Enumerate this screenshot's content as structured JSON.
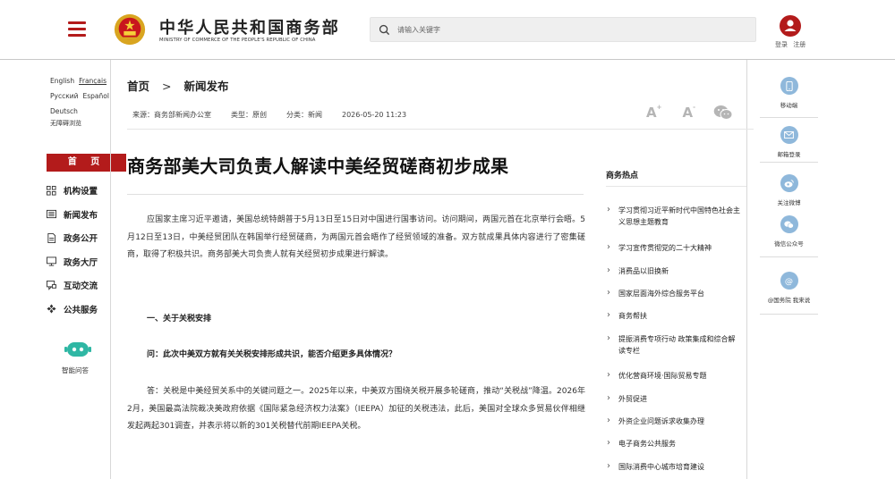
{
  "header": {
    "site_name_cn": "中华人民共和国商务部",
    "site_name_en": "MINISTRY OF COMMERCE OF THE PEOPLE'S REPUBLIC OF CHINA",
    "search_placeholder": "请输入关键字",
    "login": "登录",
    "register": "注册"
  },
  "languages": {
    "english": "English",
    "francais": "Français",
    "russian": "Русский",
    "espanol": "Español",
    "deutsch": "Deutsch",
    "accessibility": "无障碍浏览"
  },
  "left_nav": {
    "home": "首 页",
    "items": [
      {
        "label": "机构设置",
        "icon": "org-icon"
      },
      {
        "label": "新闻发布",
        "icon": "news-icon"
      },
      {
        "label": "政务公开",
        "icon": "document-icon"
      },
      {
        "label": "政务大厅",
        "icon": "monitor-icon"
      },
      {
        "label": "互动交流",
        "icon": "chat-icon"
      },
      {
        "label": "公共服务",
        "icon": "service-icon"
      }
    ],
    "chatbot_label": "智能问答"
  },
  "breadcrumb": {
    "home": "首页",
    "separator": ">",
    "current": "新闻发布"
  },
  "meta": {
    "source": "来源：商务部新闻办公室",
    "type": "类型：原创",
    "category": "分类：新闻",
    "datetime": "2026-05-20 11:23",
    "font_large": "A",
    "font_small": "A"
  },
  "article": {
    "title": "商务部美大司负责人解读中美经贸磋商初步成果",
    "paragraph1": "应国家主席习近平邀请，美国总统特朗普于5月13日至15日对中国进行国事访问。访问期间，两国元首在北京举行会晤。5月12日至13日，中美经贸团队在韩国举行经贸磋商，为两国元首会晤作了经贸领域的准备。双方就成果具体内容进行了密集磋商，取得了积极共识。商务部美大司负责人就有关经贸初步成果进行解读。",
    "section1": "一、关于关税安排",
    "question1": "问：此次中美双方就有关关税安排形成共识，能否介绍更多具体情况？",
    "answer1": "答：关税是中美经贸关系中的关键问题之一。2025年以来，中美双方围绕关税开展多轮磋商，推动“关税战”降温。2026年2月，美国最高法院裁决美政府依据《国际紧急经济权力法案》（IEEPA）加征的关税违法，此后，美国对全球众多贸易伙伴相继发起两起301调查，并表示将以新的301关税替代前期IEEPA关税。"
  },
  "hot": {
    "title": "商务热点",
    "items": [
      "学习贯彻习近平新时代中国特色社会主义思想主题教育",
      "学习宣传贯彻党的二十大精神",
      "消费品以旧换新",
      "国家层面海外综合服务平台",
      "商务帮扶",
      "提振消费专项行动 政策集成和综合解读专栏",
      "优化营商环境·国际贸易专题",
      "外贸促进",
      "外资企业问题诉求收集办理",
      "电子商务公共服务",
      "国际消费中心城市培育建设"
    ]
  },
  "rail": {
    "mobile": "移动端",
    "mail": "邮箱登录",
    "weibo": "关注微博",
    "wechat": "微信公众号",
    "at": "@国务院 我来说"
  },
  "colors": {
    "brand_red": "#b31b1b",
    "rail_blue": "#8fb8db"
  }
}
